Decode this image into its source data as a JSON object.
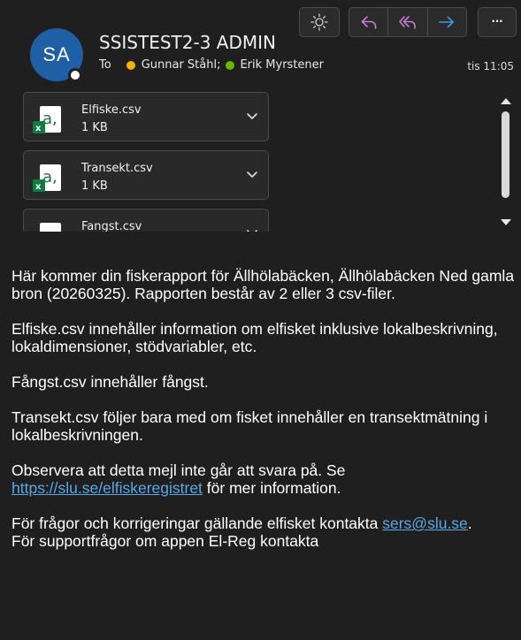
{
  "sender": {
    "initials": "SA",
    "name": "SSISTEST2-3 ADMIN"
  },
  "recipients": {
    "label": "To",
    "items": [
      {
        "name": "Gunnar Ståhl;",
        "status_color": "#f5b400"
      },
      {
        "name": "Erik Myrstener",
        "status_color": "#6bb700"
      }
    ]
  },
  "time": "tis 11:05",
  "toolbar": {
    "icons": [
      "sun-icon",
      "reply-icon",
      "reply-all-icon",
      "forward-icon",
      "more-icon"
    ],
    "more_label": "···"
  },
  "attachments": [
    {
      "name": "Elfiske.csv",
      "size": "1 KB",
      "icon": "excel-csv-icon"
    },
    {
      "name": "Transekt.csv",
      "size": "1 KB",
      "icon": "excel-csv-icon"
    },
    {
      "name": "Fangst.csv",
      "size": "",
      "icon": "excel-csv-icon"
    }
  ],
  "body": {
    "p1": "Här kommer din fiskerapport för Ällhölabäcken, Ällhölabäcken Ned gamla bron  (20260325). Rapporten består av 2 eller 3 csv-filer.",
    "p2": "Elfiske.csv innehåller information om elfisket inklusive lokalbeskrivning, lokaldimensioner, stödvariabler, etc.",
    "p3": "Fångst.csv innehåller fångst.",
    "p4": "Transekt.csv följer bara med om fisket innehåller en transektmätning i lokalbeskrivningen.",
    "p5_before": "Observera att detta mejl inte går att svara på. Se ",
    "p5_link": "https://slu.se/elfiskeregistret",
    "p5_after": " för mer information.",
    "p6_before": "För frågor och korrigeringar gällande elfisket kontakta ",
    "p6_link": "sers@slu.se",
    "p6_after": ".",
    "p7": "För supportfrågor om appen El-Reg kontakta"
  },
  "colors": {
    "link": "#5aa8e6",
    "accent_purple": "#c57ad8",
    "accent_blue": "#3d9be9",
    "avatar_bg": "#1f5fa6"
  }
}
